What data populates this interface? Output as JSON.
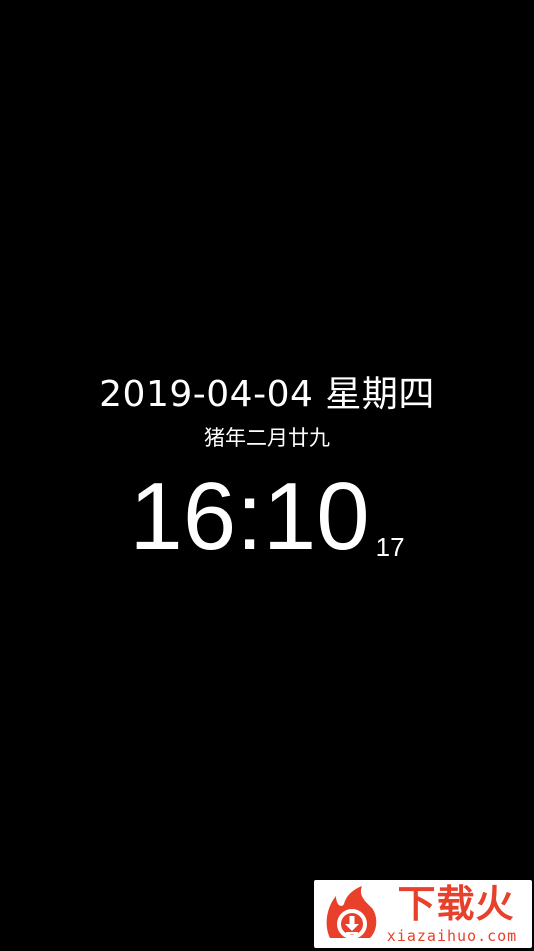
{
  "clock": {
    "date": "2019-04-04 星期四",
    "lunar_date": "猪年二月廿九",
    "time": "16:10",
    "seconds": "17"
  },
  "watermark": {
    "brand": "下载火",
    "site": "xiazaihuo.com",
    "brand_color": "#e8402a"
  },
  "colors": {
    "background": "#000000",
    "text": "#ffffff"
  }
}
